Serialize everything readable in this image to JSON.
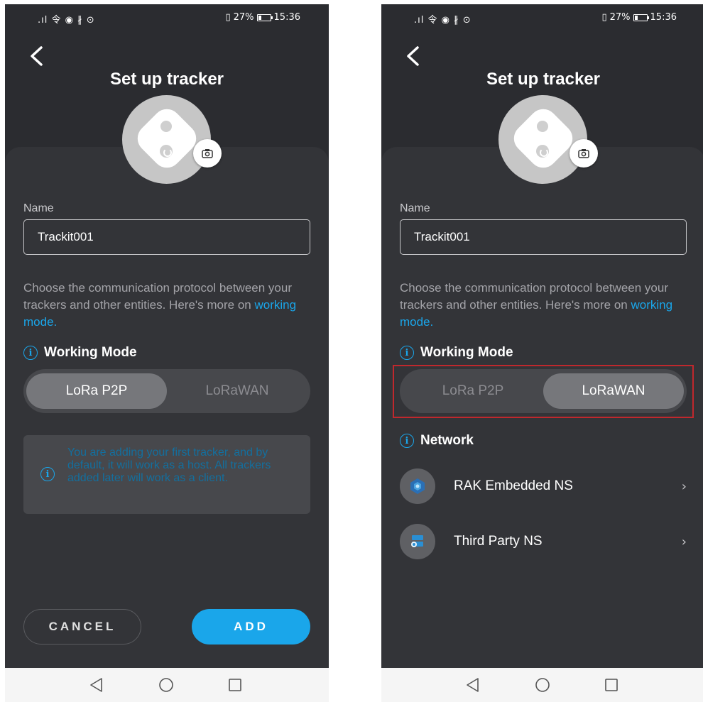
{
  "status_bar": {
    "left_icons": ".ıl 令 ◉ ∦ ⊙",
    "battery": "27%",
    "time": "15:36"
  },
  "page_title": "Set up tracker",
  "name_label": "Name",
  "name_value": "Trackit001",
  "description": "Choose the communication protocol between your trackers and other entities. Here's more on",
  "description_link": "working mode.",
  "working_mode_label": "Working Mode",
  "modes": [
    "LoRa P2P",
    "LoRaWAN"
  ],
  "left_screen": {
    "selected_mode": "LoRa P2P",
    "notice": "You are adding your first tracker, and by default, it will work as a host. All trackers added later will work as a client.",
    "cancel_label": "CANCEL",
    "add_label": "ADD"
  },
  "right_screen": {
    "selected_mode": "LoRaWAN",
    "network_label": "Network",
    "networks": [
      {
        "label": "RAK Embedded NS",
        "icon": "rak-logo-icon"
      },
      {
        "label": "Third Party NS",
        "icon": "server-icon"
      }
    ]
  },
  "colors": {
    "accent": "#1aa6ea",
    "background": "#2b2c30",
    "highlight": "#c0282d"
  }
}
